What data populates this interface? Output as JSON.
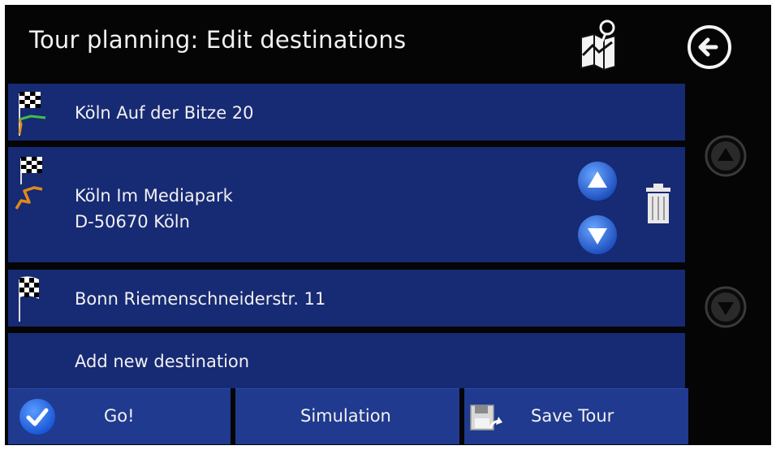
{
  "header": {
    "title": "Tour planning: Edit destinations",
    "icons": {
      "map": "map-pin-icon",
      "back": "back-arrow-icon"
    }
  },
  "destinations": [
    {
      "line1": "Köln Auf der Bitze 20",
      "line2": "",
      "icon": "checkered-flag-route-start-icon"
    },
    {
      "line1": "Köln Im Mediapark",
      "line2": "D-50670 Köln",
      "icon": "checkered-flag-route-icon",
      "selected": true
    },
    {
      "line1": "Bonn Riemenschneiderstr. 11",
      "line2": "",
      "icon": "checkered-flag-icon"
    }
  ],
  "add_destination": {
    "label": "Add new destination"
  },
  "row_controls": {
    "icons": [
      "up-arrow-icon",
      "down-arrow-icon",
      "trash-icon"
    ]
  },
  "scroll": {
    "icons": [
      "scroll-up-icon",
      "scroll-down-icon"
    ]
  },
  "bottom_bar": {
    "go_label": "Go!",
    "simulation_label": "Simulation",
    "save_label": "Save Tour"
  },
  "colors": {
    "background": "#050505",
    "row": "#172a74",
    "button": "#1f3a8e",
    "accent_blue": "#2a6fe0",
    "text": "#f1f1f1"
  }
}
